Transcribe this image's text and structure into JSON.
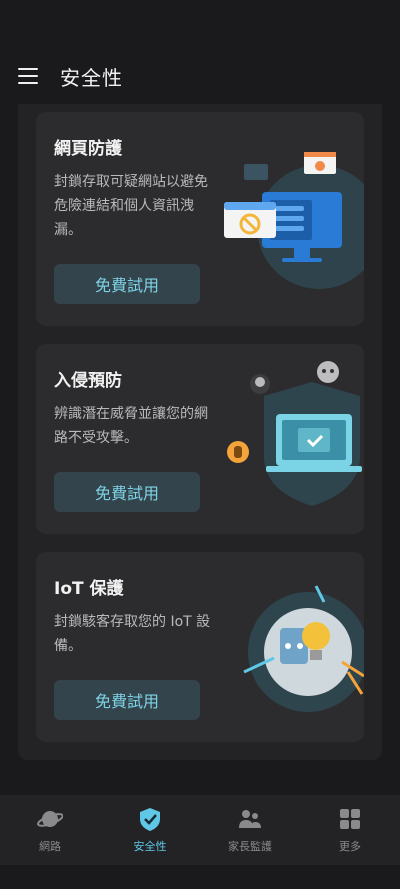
{
  "header": {
    "title": "安全性"
  },
  "cards": [
    {
      "title": "網頁防護",
      "description": "封鎖存取可疑網站以避免危險連結和個人資訊洩漏。",
      "button": "免費試用"
    },
    {
      "title": "入侵預防",
      "description": "辨識潛在威脅並讓您的網路不受攻擊。",
      "button": "免費試用"
    },
    {
      "title": "IoT 保護",
      "description": "封鎖駭客存取您的 IoT 設備。",
      "button": "免費試用"
    }
  ],
  "nav": [
    {
      "label": "網路",
      "icon": "planet-icon",
      "active": false
    },
    {
      "label": "安全性",
      "icon": "shield-check-icon",
      "active": true
    },
    {
      "label": "家長監護",
      "icon": "family-icon",
      "active": false
    },
    {
      "label": "更多",
      "icon": "grid-icon",
      "active": false
    }
  ],
  "colors": {
    "accent": "#5fc8e6",
    "card": "#2c2c2e",
    "button": "#33444c"
  }
}
